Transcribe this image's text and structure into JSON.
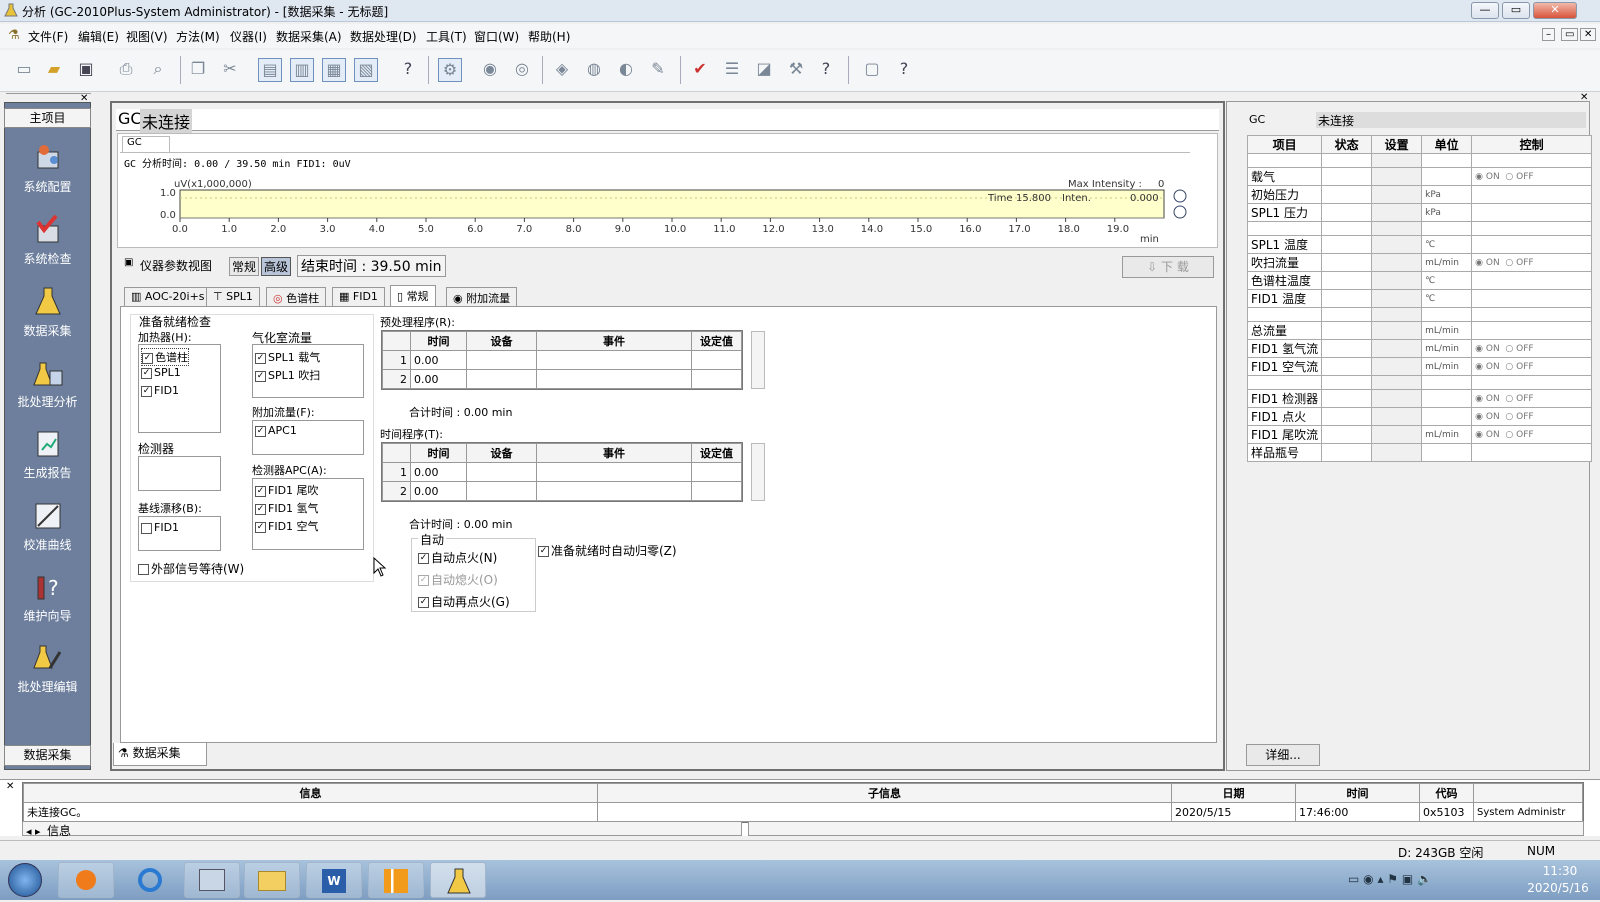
{
  "window": {
    "title": "分析 (GC-2010Plus-System Administrator) - [数据采集 - 无标题]",
    "minimize": "—",
    "restore": "▭",
    "close": "✕"
  },
  "menu": [
    "文件(F)",
    "编辑(E)",
    "视图(V)",
    "方法(M)",
    "仪器(I)",
    "数据采集(A)",
    "数据处理(D)",
    "工具(T)",
    "窗口(W)",
    "帮助(H)"
  ],
  "toolbar": {
    "help": "?"
  },
  "sidebar": {
    "header": "主项目",
    "items": [
      "系统配置",
      "系统检查",
      "数据采集",
      "批处理分析",
      "生成报告",
      "校准曲线",
      "维护向导",
      "批处理编辑"
    ],
    "footer": "数据采集"
  },
  "gc": {
    "prefix": "GC",
    "status": "未连接",
    "tab": "GC",
    "analysis_line": "GC 分析时间: 0.00 / 39.50 min FID1: 0uV"
  },
  "chart": {
    "ylabel": "uV(x1,000,000)",
    "yticks": [
      "1.0",
      "0.0"
    ],
    "xticks": [
      "0.0",
      "1.0",
      "2.0",
      "3.0",
      "4.0",
      "5.0",
      "6.0",
      "7.0",
      "8.0",
      "9.0",
      "10.0",
      "11.0",
      "12.0",
      "13.0",
      "14.0",
      "15.0",
      "16.0",
      "17.0",
      "18.0",
      "19.0"
    ],
    "xunit": "min",
    "max_intensity_label": "Max Intensity :",
    "max_intensity": "0",
    "time_label": "Time",
    "time": "15.800",
    "inten_label": "Inten.",
    "inten": "0.000"
  },
  "params": {
    "label": "仪器参数视图",
    "normal": "常规",
    "advanced": "高级",
    "endtime": "结束时间 : 39.50 min",
    "download": "下 载"
  },
  "tabs": [
    "AOC-20i+s",
    "SPL1",
    "色谱柱",
    "FID1",
    "常规",
    "附加流量"
  ],
  "form": {
    "ready_check": "准备就绪检查",
    "heater": "加热器(H):",
    "heater_items": [
      "色谱柱",
      "SPL1",
      "FID1"
    ],
    "detector": "检测器",
    "baseline": "基线漂移(B):",
    "baseline_items": [
      "FID1"
    ],
    "ext_signal": "外部信号等待(W)",
    "vapor_flow": "气化室流量",
    "vapor_items": [
      "SPL1 载气",
      "SPL1 吹扫"
    ],
    "addflow": "附加流量(F):",
    "addflow_items": [
      "APC1"
    ],
    "det_apc": "检测器APC(A):",
    "det_apc_items": [
      "FID1 尾吹",
      "FID1 氢气",
      "FID1 空气"
    ]
  },
  "pretreat": {
    "label": "预处理程序(R):",
    "headers": [
      "时间",
      "设备",
      "事件",
      "设定值"
    ],
    "rows": [
      [
        "1",
        "0.00"
      ],
      [
        "2",
        "0.00"
      ]
    ],
    "total": "合计时间 : 0.00 min"
  },
  "timeprog": {
    "label": "时间程序(T):",
    "headers": [
      "时间",
      "设备",
      "事件",
      "设定值"
    ],
    "rows": [
      [
        "1",
        "0.00"
      ],
      [
        "2",
        "0.00"
      ]
    ],
    "total": "合计时间 : 0.00 min"
  },
  "auto": {
    "label": "自动",
    "items": [
      "自动点火(N)",
      "自动熄火(O)",
      "自动再点火(G)"
    ],
    "zero": "准备就绪时自动归零(Z)"
  },
  "bottomtab": "数据采集",
  "right": {
    "gc": "GC",
    "status": "未连接",
    "headers": [
      "项目",
      "状态",
      "设置",
      "单位",
      "控制"
    ],
    "rows": [
      {
        "item": "",
        "unit": "",
        "ctrl": ""
      },
      {
        "item": "载气",
        "unit": "",
        "ctrl": "onoff"
      },
      {
        "item": "初始压力",
        "unit": "kPa",
        "ctrl": ""
      },
      {
        "item": "SPL1 压力",
        "unit": "kPa",
        "ctrl": ""
      },
      {
        "item": "",
        "unit": "",
        "ctrl": ""
      },
      {
        "item": "SPL1 温度",
        "unit": "℃",
        "ctrl": ""
      },
      {
        "item": "吹扫流量",
        "unit": "mL/min",
        "ctrl": "onoff"
      },
      {
        "item": "色谱柱温度",
        "unit": "℃",
        "ctrl": ""
      },
      {
        "item": "FID1 温度",
        "unit": "℃",
        "ctrl": ""
      },
      {
        "item": "",
        "unit": "",
        "ctrl": ""
      },
      {
        "item": "总流量",
        "unit": "mL/min",
        "ctrl": ""
      },
      {
        "item": "FID1 氢气流",
        "unit": "mL/min",
        "ctrl": "onoff"
      },
      {
        "item": "FID1 空气流",
        "unit": "mL/min",
        "ctrl": "onoff"
      },
      {
        "item": "",
        "unit": "",
        "ctrl": ""
      },
      {
        "item": "FID1 检测器",
        "unit": "",
        "ctrl": "onoff"
      },
      {
        "item": "FID1 点火",
        "unit": "",
        "ctrl": "onoff"
      },
      {
        "item": "FID1 尾吹流",
        "unit": "mL/min",
        "ctrl": "onoff"
      },
      {
        "item": "样品瓶号",
        "unit": "",
        "ctrl": ""
      }
    ],
    "on": "ON",
    "off": "OFF",
    "detail": "详细..."
  },
  "log": {
    "headers": [
      "信息",
      "子信息",
      "日期",
      "时间",
      "代码"
    ],
    "row": [
      "未连接GC。",
      "",
      "2020/5/15",
      "17:46:00",
      "0x5103",
      "System Administr"
    ],
    "tab": "信息"
  },
  "status": {
    "disk": "D: 243GB 空闲",
    "num": "NUM"
  },
  "taskbar": {
    "time": "11:30",
    "date": "2020/5/16"
  }
}
